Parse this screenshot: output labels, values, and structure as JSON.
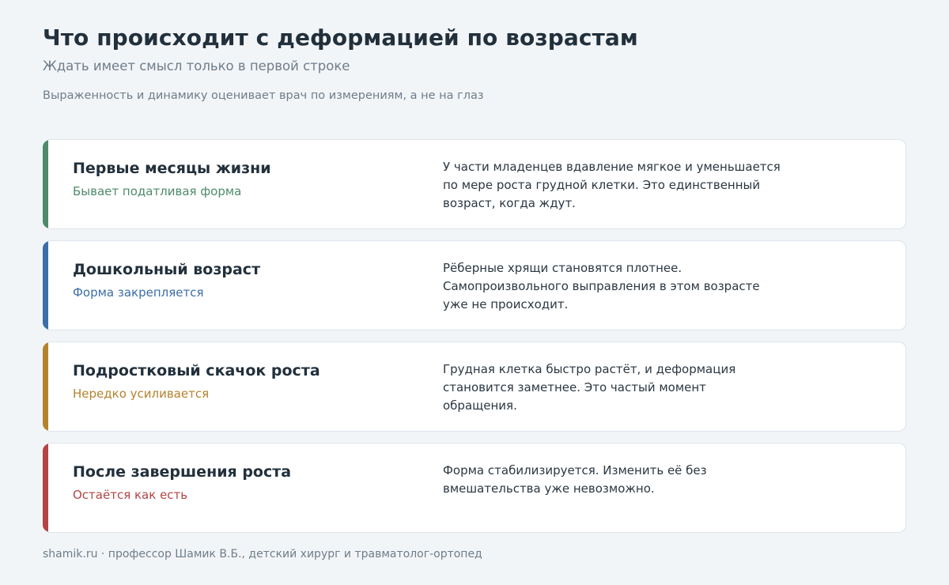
{
  "header": {
    "title": "Что происходит с деформацией по возрастам",
    "subtitle": "Ждать имеет смысл только в первой строке",
    "note": "Выраженность и динамику оценивает врач по измерениям, а не на глаз"
  },
  "stages": [
    {
      "title": "Первые месяцы жизни",
      "status": "Бывает податливая форма",
      "description": "У части младенцев вдавление мягкое и уменьшается по мере роста грудной клетки. Это единственный возраст, когда ждут.",
      "color": "#4f8a6b"
    },
    {
      "title": "Дошкольный возраст",
      "status": "Форма закрепляется",
      "description": "Рёберные хрящи становятся плотнее. Самопроизвольного выправления в этом возрасте уже не происходит.",
      "color": "#3a6ea8"
    },
    {
      "title": "Подростковый скачок роста",
      "status": "Нередко усиливается",
      "description": "Грудная клетка быстро растёт, и деформация становится заметнее. Это частый момент обращения.",
      "color": "#b5822c"
    },
    {
      "title": "После завершения роста",
      "status": "Остаётся как есть",
      "description": "Форма стабилизируется. Изменить её без вмешательства уже невозможно.",
      "color": "#b34545"
    }
  ],
  "footer": {
    "text": "shamik.ru · профессор Шамик В.Б., детский хирург и травматолог-ортопед"
  }
}
